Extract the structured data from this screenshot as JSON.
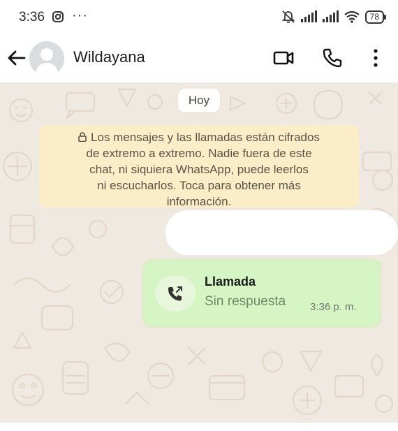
{
  "status_bar": {
    "time": "3:36",
    "dots": "···",
    "battery": "78",
    "icons": [
      "instagram-icon",
      "notifications-muted-icon",
      "signal-icon",
      "signal-icon",
      "wifi-icon",
      "battery-icon"
    ]
  },
  "header": {
    "contact_name": "Wildayana",
    "icons": [
      "back-arrow-icon",
      "avatar-placeholder",
      "video-call-icon",
      "phone-icon",
      "more-options-icon"
    ]
  },
  "chat": {
    "date_chip": "Hoy",
    "encryption_notice": {
      "icon": "lock-icon",
      "lines": [
        "Los mensajes y las llamadas están cifrados",
        "de extremo a extremo. Nadie fuera de este",
        "chat, ni siquiera WhatsApp, puede leerlos",
        "ni escucharlos. Toca para obtener más",
        "información."
      ]
    },
    "call_message": {
      "title": "Llamada",
      "status": "Sin respuesta",
      "time": "3:36 p. m.",
      "icon": "missed-outgoing-call-icon"
    }
  },
  "colors": {
    "chat_background": "#efe9e1",
    "notice_background": "#fbedc7",
    "outgoing_bubble": "#d6f5c4"
  }
}
